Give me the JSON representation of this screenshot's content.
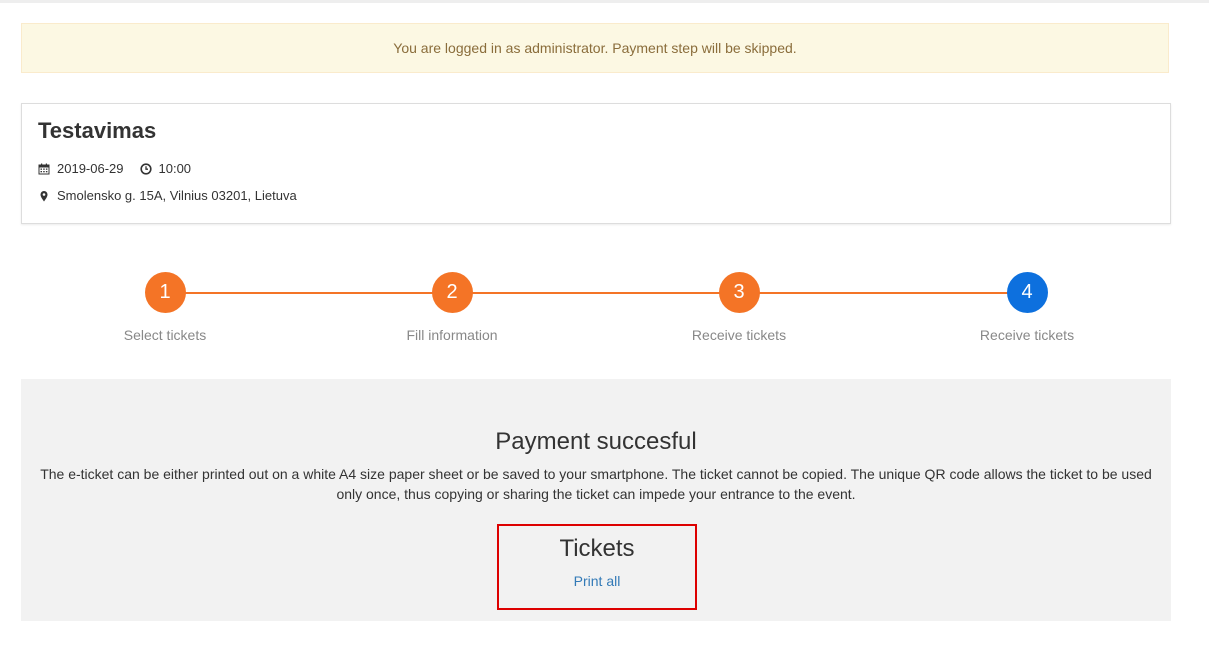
{
  "alert": {
    "message": "You are logged in as administrator. Payment step will be skipped."
  },
  "event": {
    "title": "Testavimas",
    "date": "2019-06-29",
    "time": "10:00",
    "address": "Smolensko g. 15A, Vilnius 03201, Lietuva",
    "icons": [
      "calendar-icon",
      "clock-icon",
      "map-marker-icon"
    ]
  },
  "steps": [
    {
      "number": "1",
      "label": "Select tickets",
      "state": "completed"
    },
    {
      "number": "2",
      "label": "Fill information",
      "state": "completed"
    },
    {
      "number": "3",
      "label": "Receive tickets",
      "state": "completed"
    },
    {
      "number": "4",
      "label": "Receive tickets",
      "state": "active"
    }
  ],
  "result": {
    "title": "Payment succesful",
    "text": "The e-ticket can be either printed out on a white A4 size paper sheet or be saved to your smartphone. The ticket cannot be copied. The unique QR code allows the ticket to be used only once, thus copying or sharing the ticket can impede your entrance to the event.",
    "tickets_title": "Tickets",
    "print_all_label": "Print all"
  },
  "colors": {
    "step_completed": "#f47426",
    "step_active": "#0d70de",
    "alert_bg": "#fcf8e3",
    "alert_text": "#8a6d3b",
    "link": "#337ab7",
    "highlight_border": "#dd0000"
  }
}
